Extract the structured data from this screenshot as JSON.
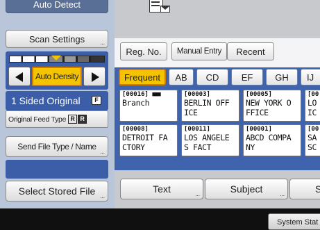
{
  "left_panel": {
    "auto_detect": "Auto Detect",
    "scan_settings": "Scan Settings",
    "density": "Auto Density",
    "sided_original": "1 Sided Original",
    "feed_type": "Original Feed Type",
    "send_file_type": "Send File Type / Name",
    "select_stored_file": "Select Stored File",
    "dots": "..."
  },
  "top_tabs": [
    "Reg. No.",
    "Manual Entry",
    "Recent"
  ],
  "filter_tabs": [
    "Frequent",
    "AB",
    "CD",
    "EF",
    "GH",
    "IJ"
  ],
  "destinations": [
    {
      "num": "[00016]",
      "name": "Branch"
    },
    {
      "num": "[00003]",
      "name": "BERLIN OFF\nICE"
    },
    {
      "num": "[00005]",
      "name": "NEW YORK O\nFFICE"
    },
    {
      "num": "[00",
      "name": "LO\nIC"
    },
    {
      "num": "[00008]",
      "name": "DETROIT FA\nCTORY"
    },
    {
      "num": "[00011]",
      "name": "LOS ANGELE\nS FACT"
    },
    {
      "num": "[00001]",
      "name": "ABCD COMPA\nNY"
    },
    {
      "num": "[00",
      "name": "SA\nSC"
    }
  ],
  "bottom_buttons": {
    "text": "Text",
    "subject": "Subject",
    "more": "S"
  },
  "system_status": "System Stat",
  "colors": {
    "panel_blue": "#3c5ea8",
    "highlight": "#f5c400",
    "accent_border": "#d07a00"
  }
}
